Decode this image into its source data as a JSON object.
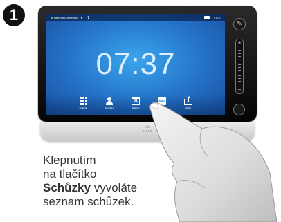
{
  "step": {
    "number": "1"
  },
  "device": {
    "brand": "cisco",
    "status_bar": {
      "user": "Bernhard Johnsson",
      "caret": "▼",
      "info": "❢",
      "time": "07:37"
    },
    "clock": "07:37",
    "taskbar": [
      {
        "label": "Ćiselník",
        "icon": "grid-icon"
      },
      {
        "label": "Kontakty",
        "icon": "person-icon"
      },
      {
        "label": "Schůzky",
        "icon": "calendar-icon",
        "icon_text": "31"
      },
      {
        "label": "Zprávy",
        "icon": "message-icon",
        "icon_text": "MSG"
      },
      {
        "label": "Sdílet",
        "icon": "share-icon"
      }
    ],
    "side": {
      "mute": "✎",
      "vol_plus": "+",
      "vol_minus": "−",
      "info": "i"
    }
  },
  "caption": {
    "line1": "Klepnutím",
    "line2": "na tlačítko",
    "bold": "Schůzky",
    "line3_rest": " vyvoláte",
    "line4": "seznam schůzek."
  },
  "colors": {
    "screen": "#2472c8",
    "badge": "#111111",
    "text": "#333333"
  }
}
